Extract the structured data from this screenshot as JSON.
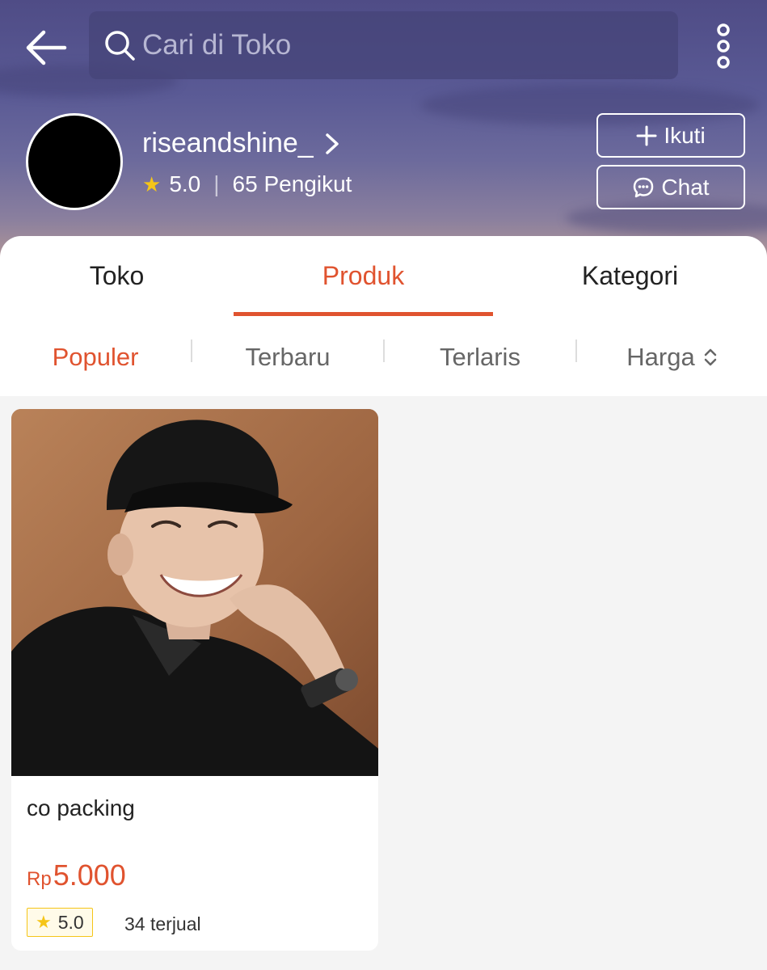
{
  "header": {
    "search_placeholder": "Cari di Toko",
    "shop_name": "riseandshine_",
    "rating": "5.0",
    "followers": "65 Pengikut",
    "follow_label": "Ikuti",
    "chat_label": "Chat"
  },
  "tabs": [
    {
      "label": "Toko"
    },
    {
      "label": "Produk"
    },
    {
      "label": "Kategori"
    }
  ],
  "sort": [
    {
      "label": "Populer"
    },
    {
      "label": "Terbaru"
    },
    {
      "label": "Terlaris"
    },
    {
      "label": "Harga"
    }
  ],
  "product": {
    "title": "co packing",
    "currency": "Rp",
    "price": "5.000",
    "rating": "5.0",
    "sold": "34 terjual"
  },
  "colors": {
    "accent": "#e0532f",
    "star": "#f5c518"
  }
}
